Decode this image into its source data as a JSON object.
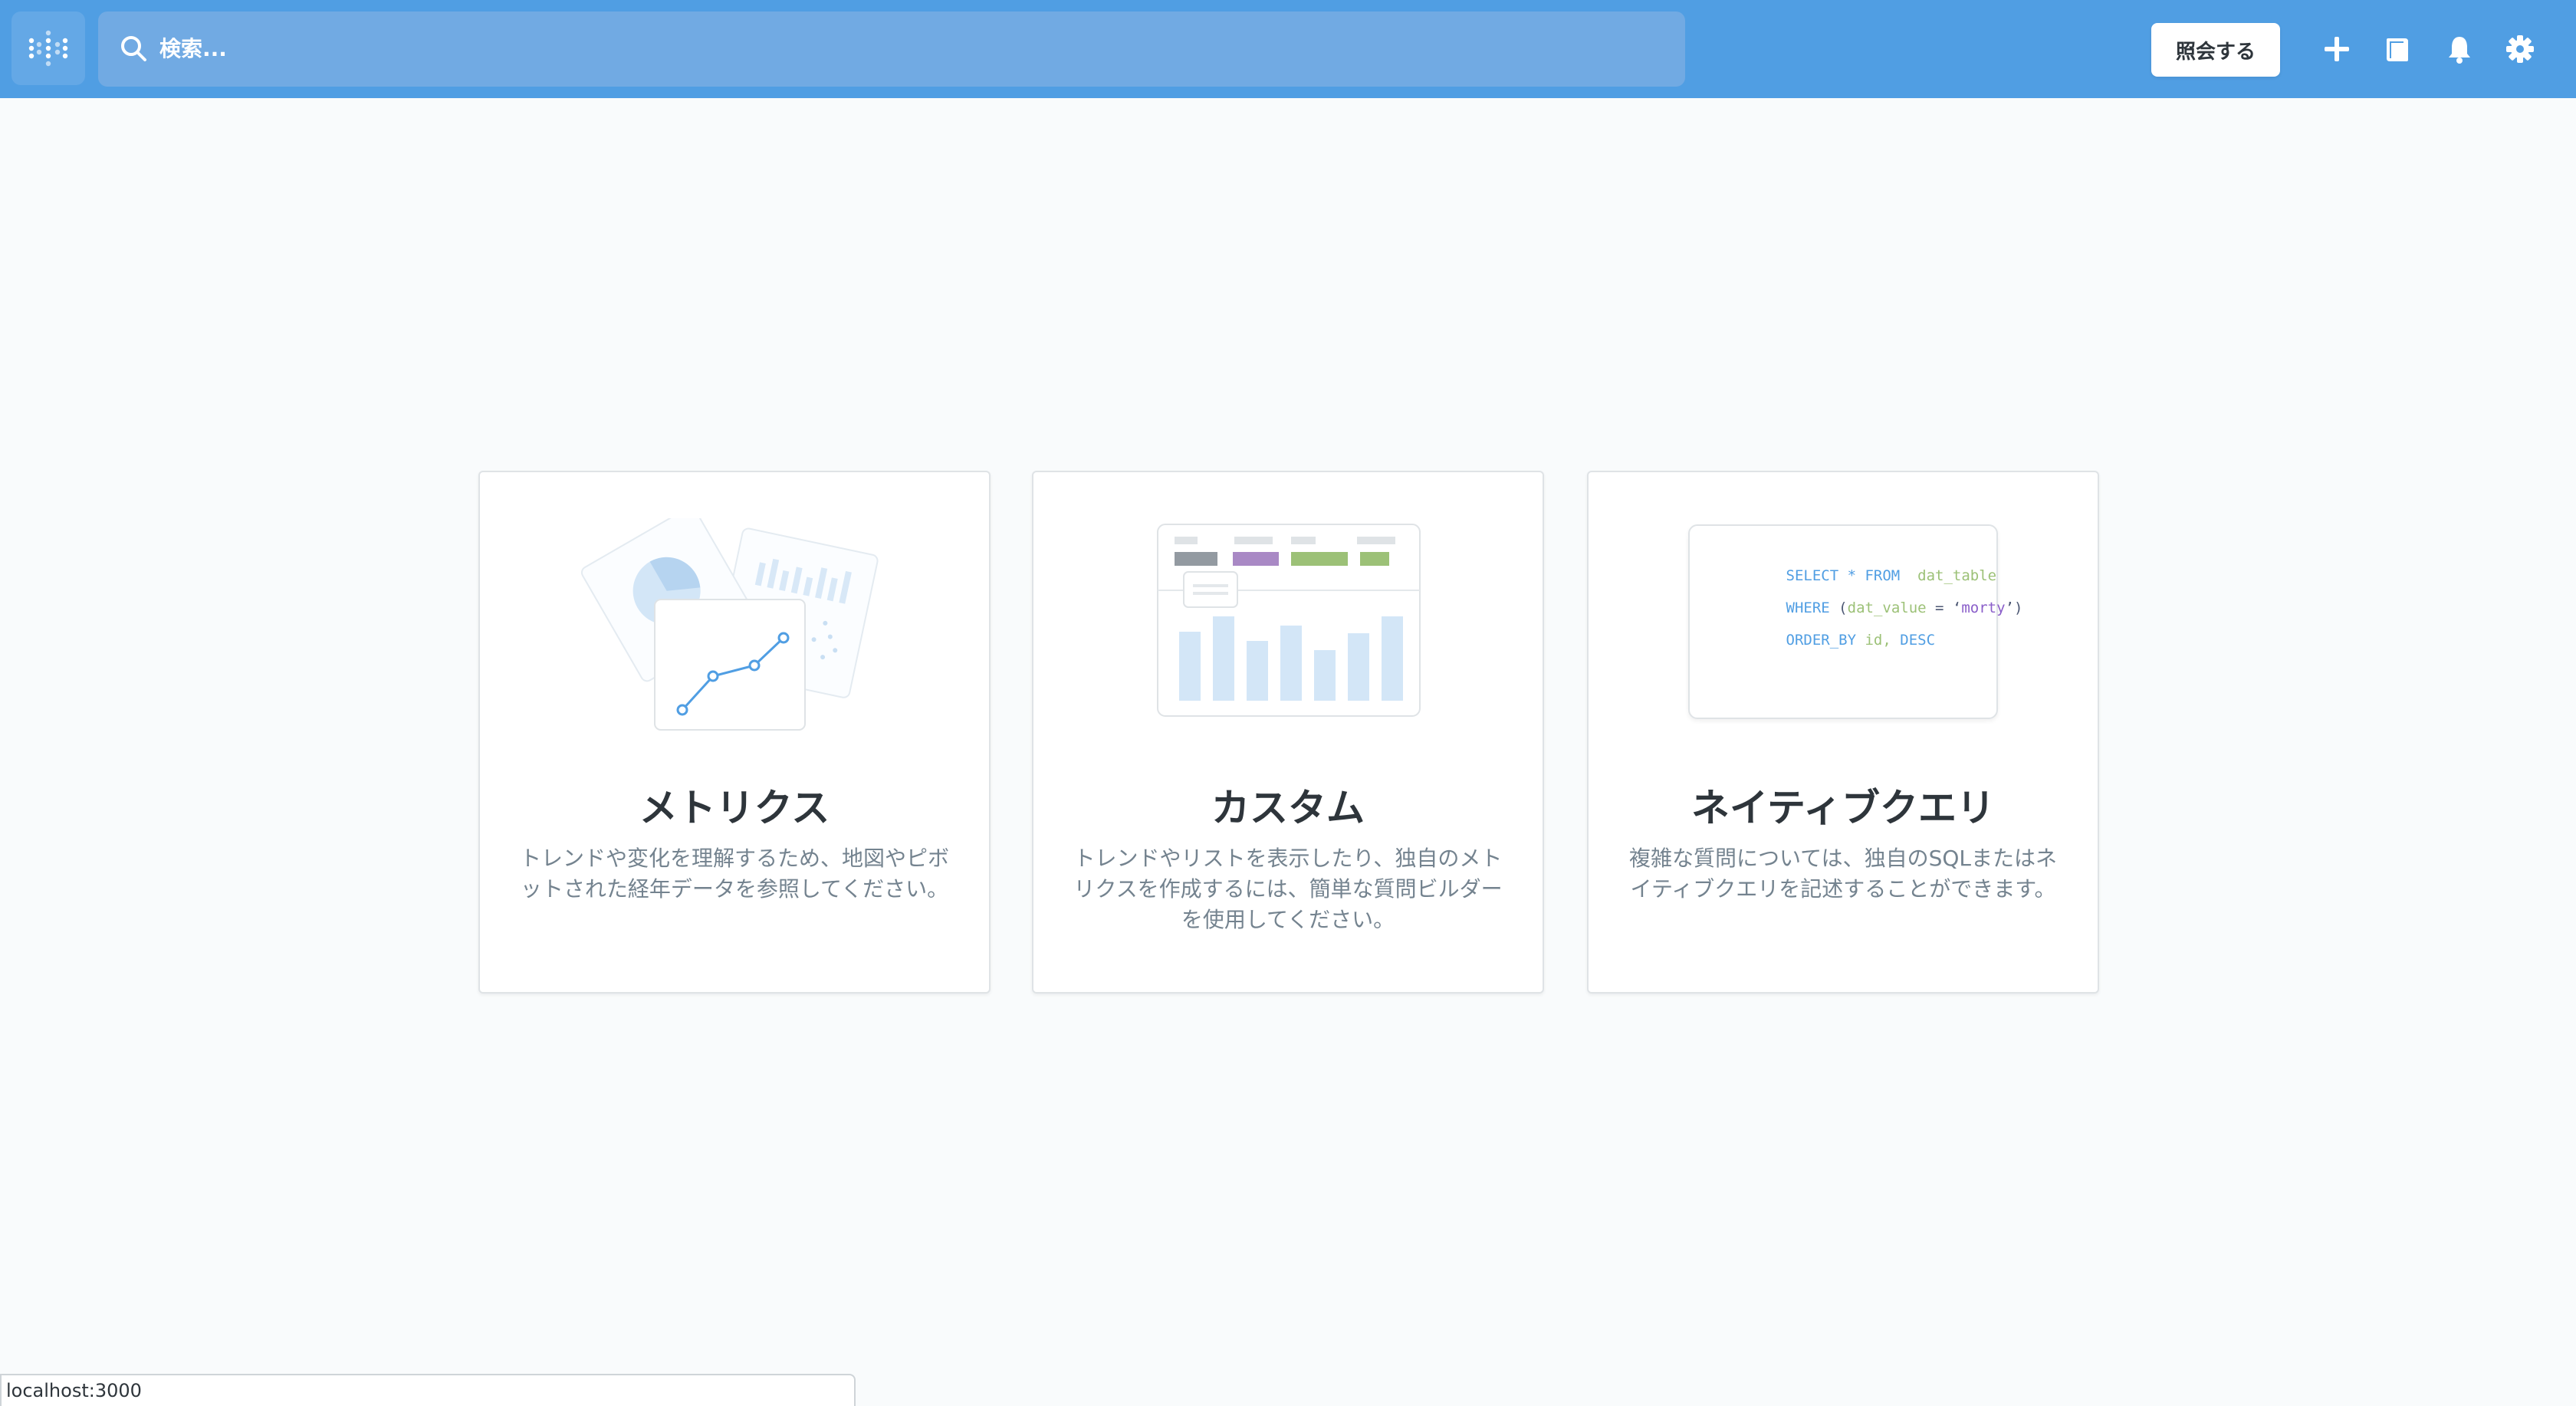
{
  "nav": {
    "search_placeholder": "検索...",
    "ask_button": "照会する",
    "icons": [
      "plus-icon",
      "collection-icon",
      "bell-icon",
      "gear-icon"
    ],
    "accent": "#509ee3"
  },
  "cards": [
    {
      "title": "メトリクス",
      "description": "トレンドや変化を理解するため、地図やピボットされた経年データを参照してください。"
    },
    {
      "title": "カスタム",
      "description": "トレンドやリストを表示したり、独自のメトリクスを作成するには、簡単な質問ビルダーを使用してください。"
    },
    {
      "title": "ネイティブクエリ",
      "description": "複雑な質問については、独自のSQLまたはネイティブクエリを記述することができます。",
      "sql": {
        "line1_kw": "SELECT * FROM",
        "line1_table": "dat_table",
        "line2_kw": "WHERE",
        "line2_rest_open": "(",
        "line2_col": "dat_value",
        "line2_eq": " = ‘",
        "line2_val": "morty",
        "line2_close": "’)",
        "line3_kw": "ORDER_BY",
        "line3_col": "id,",
        "line3_dir": "DESC"
      }
    }
  ],
  "status_bar": {
    "url": "localhost:3000"
  }
}
